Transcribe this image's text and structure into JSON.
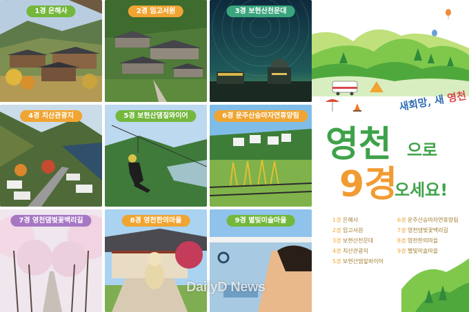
{
  "tiles": [
    {
      "label": "1경 은해사",
      "label_color": "#74b73d"
    },
    {
      "label": "2경 임고서원",
      "label_color": "#f0a532"
    },
    {
      "label": "3경 보현산천문대",
      "label_color": "#3aa57d"
    },
    {
      "label": "4경 치산관광지",
      "label_color": "#f0a532"
    },
    {
      "label": "5경 보현산댐짚와이어",
      "label_color": "#74b73d"
    },
    {
      "label": "6경 운주산승마자연휴양림",
      "label_color": "#f0a532"
    },
    {
      "label": "7경 영천댐벚꽃백리길",
      "label_color": "#a777c4"
    },
    {
      "label": "8경 영천한의마을",
      "label_color": "#f0a532"
    },
    {
      "label": "9경 별빛미술마을",
      "label_color": "#74b73d"
    }
  ],
  "poster": {
    "slogan_prefix": "새희망, 새",
    "slogan_city": "영천",
    "headline_1": "영천",
    "headline_2": "으로",
    "headline_3": "9경",
    "headline_4": "오세요!",
    "legend_left": [
      {
        "num": "1경",
        "name": "은해사"
      },
      {
        "num": "2경",
        "name": "임고서원"
      },
      {
        "num": "3경",
        "name": "보현산천문대"
      },
      {
        "num": "4경",
        "name": "치산관광지"
      },
      {
        "num": "5경",
        "name": "보현산댐짚와이어"
      }
    ],
    "legend_right": [
      {
        "num": "6경",
        "name": "운주산승마자연휴양림"
      },
      {
        "num": "7경",
        "name": "영천댐벚꽃백리길"
      },
      {
        "num": "8경",
        "name": "영천한의마을"
      },
      {
        "num": "9경",
        "name": "별빛미술마을"
      }
    ]
  },
  "watermark": "DailyD News",
  "colors": {
    "green": "#3fa24a",
    "orange": "#f19b32",
    "legend_text": "#9f7c2f"
  }
}
